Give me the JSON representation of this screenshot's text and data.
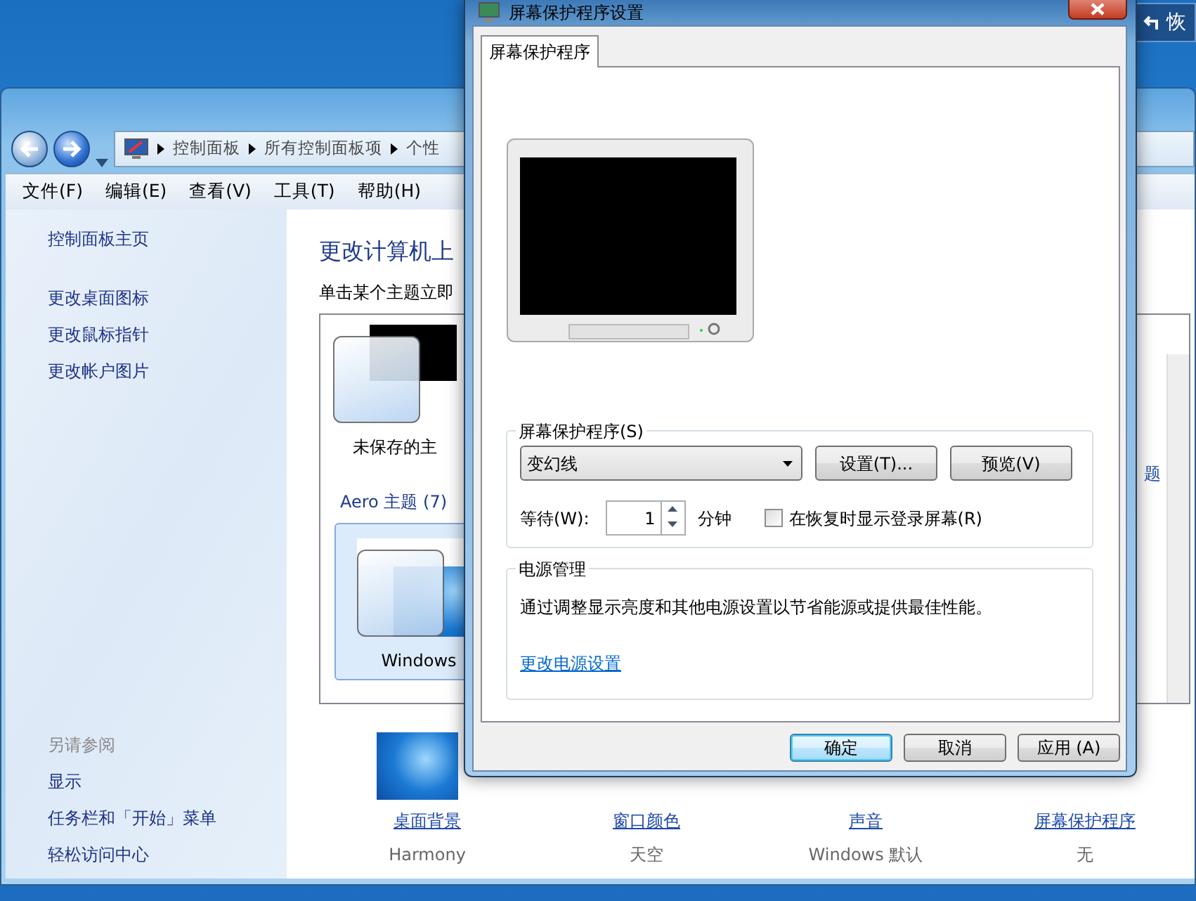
{
  "desktop": {
    "corner_button": {
      "label": "恢"
    }
  },
  "window": {
    "address": [
      "控制面板",
      "所有控制面板项",
      "个性"
    ],
    "menu": [
      "文件(F)",
      "编辑(E)",
      "查看(V)",
      "工具(T)",
      "帮助(H)"
    ],
    "sidebar": {
      "links": [
        "控制面板主页",
        "更改桌面图标",
        "更改鼠标指针",
        "更改帐户图片"
      ],
      "see_also_title": "另请参阅",
      "see_also": [
        "显示",
        "任务栏和「开始」菜单",
        "轻松访问中心"
      ]
    },
    "main": {
      "title": "更改计算机上",
      "subtitle": "单击某个主题立即",
      "themes": [
        {
          "name": "未保存的主",
          "selected": false
        }
      ],
      "more_link": "题",
      "group": "Aero 主题 (7)",
      "aero_themes": [
        {
          "name": "Windows",
          "selected": true
        }
      ],
      "settings": [
        {
          "kind": "wallpaper",
          "label": "桌面背景",
          "value": "Harmony"
        },
        {
          "kind": "color",
          "label": "窗口颜色",
          "value": "天空"
        },
        {
          "kind": "sound",
          "label": "声音",
          "value": "Windows 默认"
        },
        {
          "kind": "screensaver",
          "label": "屏幕保护程序",
          "value": "无"
        }
      ]
    }
  },
  "dialog": {
    "title": "屏幕保护程序设置",
    "tabs": [
      {
        "label": "屏幕保护程序",
        "selected": true
      }
    ],
    "saver_group": {
      "legend": "屏幕保护程序(S)",
      "select_value": "变幻线",
      "buttons": [
        "设置(T)...",
        "预览(V)"
      ],
      "wait_label": "等待(W):",
      "wait_value": "1",
      "wait_unit": "分钟",
      "logon_checkbox": {
        "label": "在恢复时显示登录屏幕(R)",
        "checked": false
      }
    },
    "power_group": {
      "legend": "电源管理",
      "text": "通过调整显示亮度和其他电源设置以节省能源或提供最佳性能。",
      "link": "更改电源设置"
    },
    "buttons": [
      {
        "label": "确定",
        "default": true
      },
      {
        "label": "取消",
        "default": false
      },
      {
        "label": "应用 (A)",
        "default": false
      }
    ]
  }
}
